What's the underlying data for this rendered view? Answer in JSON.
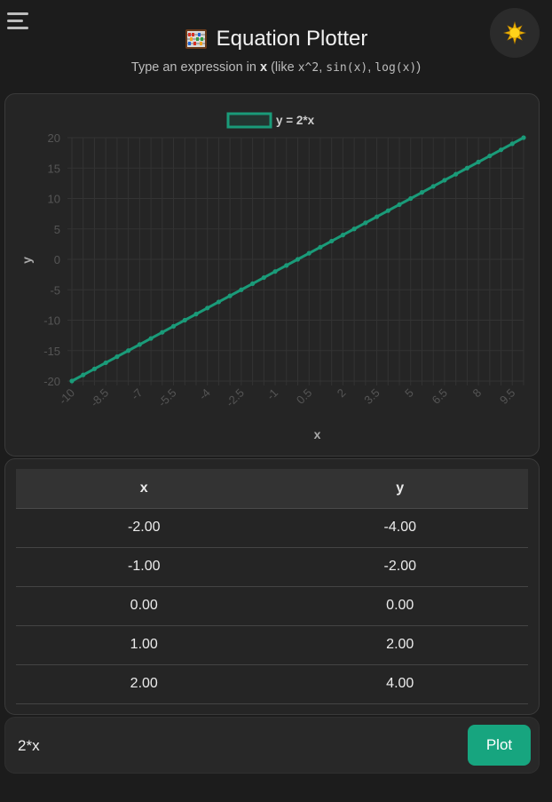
{
  "header": {
    "title": "Equation Plotter",
    "subtitle_prefix": "Type an expression in ",
    "subtitle_var": "x",
    "subtitle_mid": " (like ",
    "example_1": "x^2",
    "sep_1": ", ",
    "example_2": "sin(x)",
    "sep_2": ", ",
    "example_3": "log(x)",
    "subtitle_suffix": ")",
    "title_icon": "abacus-icon",
    "menu_icon": "hamburger-icon",
    "theme_icon": "sun-icon"
  },
  "chart_data": {
    "type": "line",
    "legend_label": "y = 2*x",
    "legend_position": "top",
    "xlabel": "x",
    "ylabel": "y",
    "x_ticks": [
      "-10",
      "-8.5",
      "-7",
      "-5.5",
      "-4",
      "-2.5",
      "-1",
      "0.5",
      "2",
      "3.5",
      "5",
      "6.5",
      "8",
      "9.5"
    ],
    "y_ticks": [
      "20",
      "15",
      "10",
      "5",
      "0",
      "-5",
      "-10",
      "-15",
      "-20"
    ],
    "xlim": [
      -10,
      10
    ],
    "ylim": [
      -20,
      20
    ],
    "x_step": 0.5,
    "grid": true,
    "series": [
      {
        "name": "y = 2*x",
        "expression": "2*x",
        "x_start": -10,
        "x_end": 10,
        "slope": 2,
        "intercept": 0
      }
    ],
    "color": "#1a9b79"
  },
  "table": {
    "columns": [
      "x",
      "y"
    ],
    "rows": [
      [
        "-2.00",
        "-4.00"
      ],
      [
        "-1.00",
        "-2.00"
      ],
      [
        "0.00",
        "0.00"
      ],
      [
        "1.00",
        "2.00"
      ],
      [
        "2.00",
        "4.00"
      ]
    ]
  },
  "input": {
    "value": "2*x",
    "button_label": "Plot"
  },
  "colors": {
    "accent": "#17a57f",
    "background": "#1c1c1c",
    "card": "#252525"
  }
}
